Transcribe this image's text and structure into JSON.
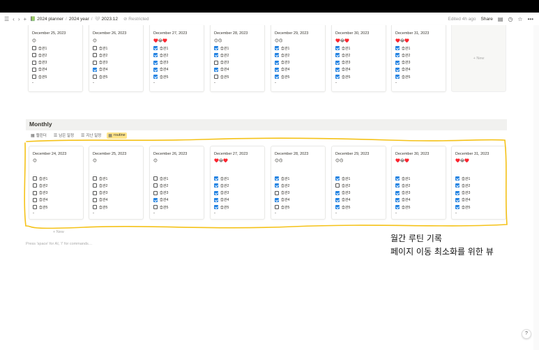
{
  "nav": {
    "crumbs": [
      "2024 planner",
      "2024 year",
      "2023.12"
    ],
    "restricted": "Restricted",
    "edited": "Edited 4h ago",
    "share": "Share"
  },
  "top_cards": [
    {
      "date": "December 25, 2023",
      "emoji": "😊",
      "tasks": [
        false,
        false,
        false,
        false,
        false
      ]
    },
    {
      "date": "December 26, 2023",
      "emoji": "😊",
      "tasks": [
        false,
        false,
        false,
        true,
        false
      ]
    },
    {
      "date": "December 27, 2023",
      "emoji": "♥️😂♥️",
      "tasks": [
        true,
        true,
        true,
        true,
        true
      ]
    },
    {
      "date": "December 28, 2023",
      "emoji": "😊🙃",
      "tasks": [
        true,
        true,
        false,
        true,
        false
      ]
    },
    {
      "date": "December 29, 2023",
      "emoji": "😊🙃",
      "tasks": [
        true,
        true,
        true,
        true,
        true
      ]
    },
    {
      "date": "December 30, 2023",
      "emoji": "♥️😂♥️",
      "tasks": [
        true,
        true,
        true,
        true,
        true
      ]
    },
    {
      "date": "December 31, 2023",
      "emoji": "♥️😂♥️",
      "tasks": [
        true,
        true,
        true,
        true,
        true
      ]
    }
  ],
  "task_labels": [
    "습관1",
    "습관2",
    "습관3",
    "습관4",
    "습관5"
  ],
  "dash": "-",
  "new_label": "+ New",
  "monthly": {
    "title": "Monthly",
    "views": [
      {
        "icon": "calendar-icon",
        "label": "캘린더"
      },
      {
        "icon": "list-icon",
        "label": "남은 일정"
      },
      {
        "icon": "list-icon",
        "label": "지난 일정"
      },
      {
        "icon": "table-icon",
        "label": "routine"
      }
    ]
  },
  "monthly_cards": [
    {
      "date": "December 24, 2023",
      "emoji": "😊",
      "tasks": [
        false,
        false,
        false,
        false,
        false
      ]
    },
    {
      "date": "December 25, 2023",
      "emoji": "😊",
      "tasks": [
        false,
        false,
        false,
        false,
        false
      ]
    },
    {
      "date": "December 26, 2023",
      "emoji": "😊",
      "tasks": [
        false,
        false,
        false,
        true,
        false
      ]
    },
    {
      "date": "December 27, 2023",
      "emoji": "♥️😂♥️",
      "tasks": [
        true,
        true,
        true,
        true,
        true
      ]
    },
    {
      "date": "December 28, 2023",
      "emoji": "😊🙃",
      "tasks": [
        true,
        true,
        false,
        true,
        false
      ]
    },
    {
      "date": "December 29, 2023",
      "emoji": "😊🙃",
      "tasks": [
        true,
        false,
        true,
        true,
        true
      ]
    },
    {
      "date": "December 30, 2023",
      "emoji": "♥️😂♥️",
      "tasks": [
        true,
        true,
        true,
        true,
        true
      ]
    },
    {
      "date": "December 31, 2023",
      "emoji": "♥️😂♥️",
      "tasks": [
        true,
        true,
        true,
        true,
        true
      ]
    }
  ],
  "press_hint": "Press 'space' for AI, '/' for commands…",
  "note": [
    "월간 루틴 기록",
    "페이지 이동 최소화를 위한 뷰"
  ],
  "help": "?",
  "colors": {
    "highlight": "#f5c218",
    "accent": "#2383e2",
    "active_view": "#ffe58a"
  }
}
